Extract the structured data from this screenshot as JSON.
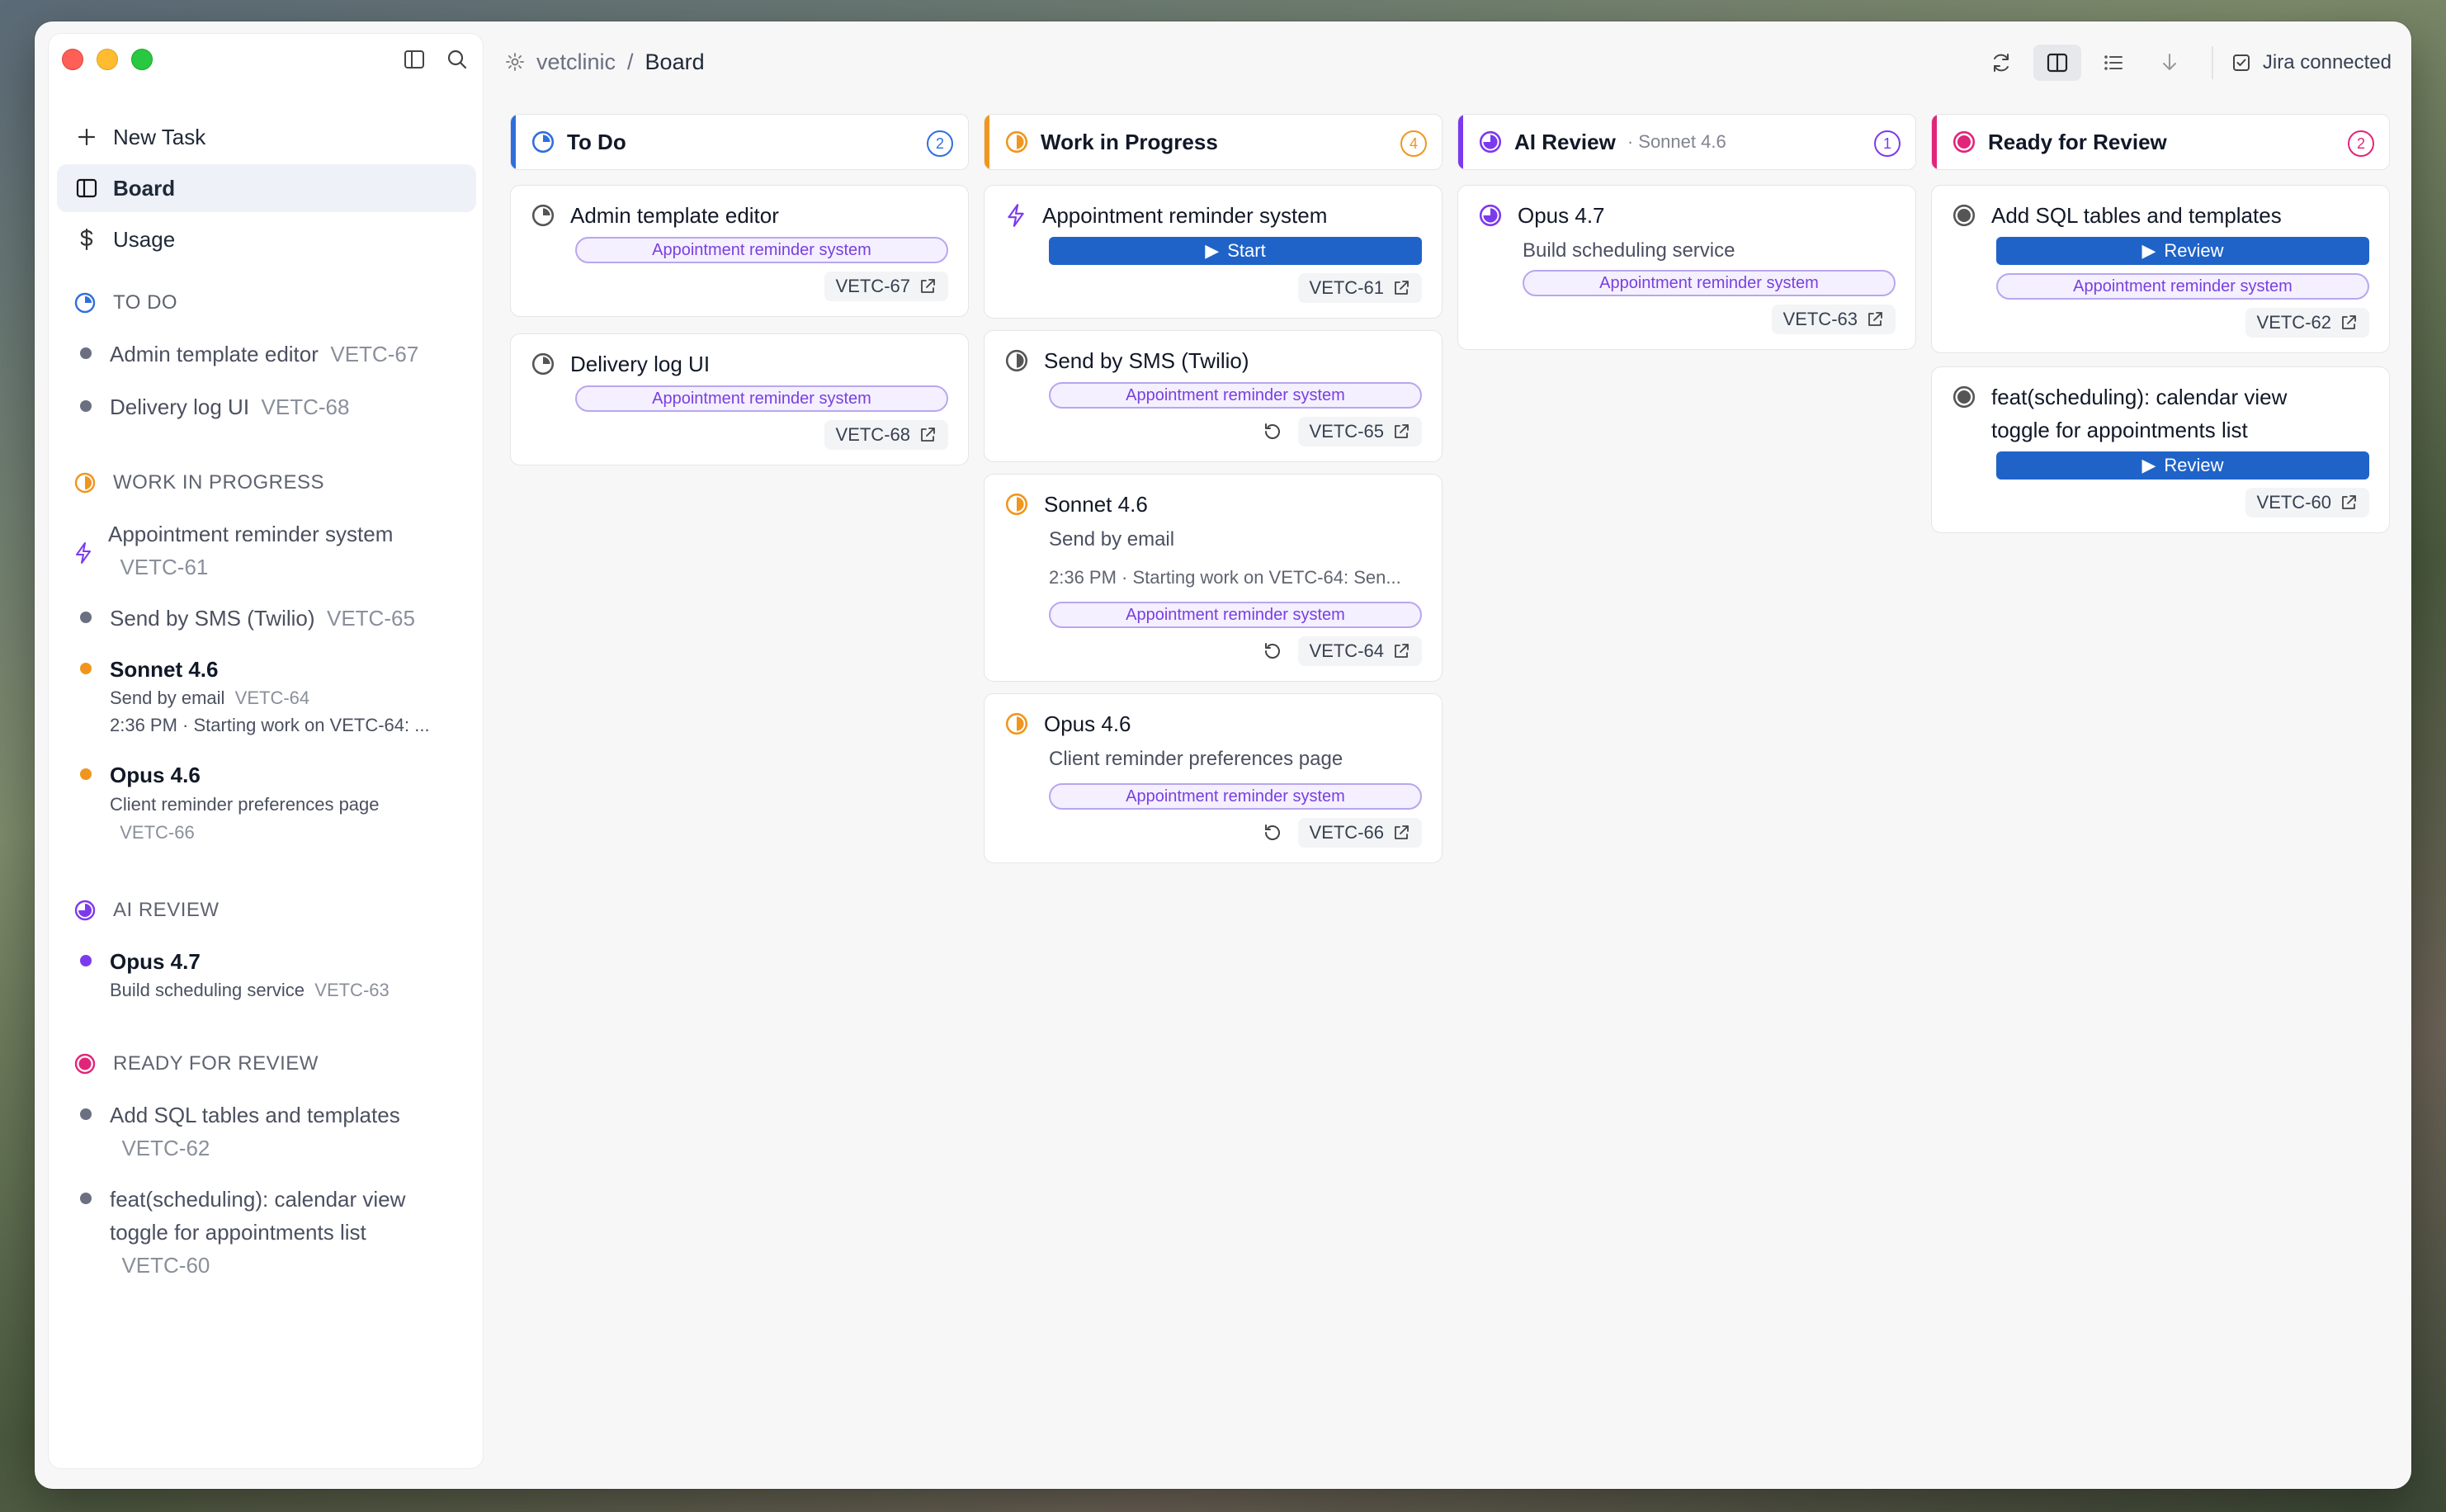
{
  "header": {
    "workspace": "vetclinic",
    "separator": "/",
    "page": "Board",
    "jira_status": "Jira connected"
  },
  "sidebar": {
    "nav": [
      {
        "label": "New Task",
        "icon": "plus-icon"
      },
      {
        "label": "Board",
        "icon": "board-icon"
      },
      {
        "label": "Usage",
        "icon": "dollar-icon"
      }
    ],
    "sections": [
      {
        "title": "TO DO",
        "items": [
          {
            "title": "Admin template editor",
            "key": "VETC-67"
          },
          {
            "title": "Delivery log UI",
            "key": "VETC-68"
          }
        ]
      },
      {
        "title": "WORK IN PROGRESS",
        "items": [
          {
            "title": "Appointment reminder system",
            "key": "VETC-61"
          },
          {
            "title": "Send by SMS (Twilio)",
            "key": "VETC-65"
          },
          {
            "agent": "Sonnet 4.6",
            "title": "Send by email",
            "key": "VETC-64",
            "log": "2:36 PM · Starting work on VETC-64: ..."
          },
          {
            "agent": "Opus 4.6",
            "title": "Client reminder preferences page",
            "key": "VETC-66"
          }
        ]
      },
      {
        "title": "AI REVIEW",
        "items": [
          {
            "agent": "Opus 4.7",
            "title": "Build scheduling service",
            "key": "VETC-63"
          }
        ]
      },
      {
        "title": "READY FOR REVIEW",
        "items": [
          {
            "title": "Add SQL tables and templates",
            "key": "VETC-62"
          },
          {
            "title_line1": "feat(scheduling): calendar view",
            "title_line2": "toggle for appointments list",
            "key": "VETC-60"
          }
        ]
      }
    ]
  },
  "columns": [
    {
      "title": "To Do",
      "count": "2",
      "color": "#2f6fdc",
      "cards": [
        {
          "title": "Admin template editor",
          "tag": "Appointment reminder system",
          "key": "VETC-67"
        },
        {
          "title": "Delivery log UI",
          "tag": "Appointment reminder system",
          "key": "VETC-68"
        }
      ]
    },
    {
      "title": "Work in Progress",
      "count": "4",
      "color": "#f0961e",
      "cards": [
        {
          "title": "Appointment reminder system",
          "button": "Start",
          "key": "VETC-61"
        },
        {
          "title": "Send by SMS (Twilio)",
          "tag": "Appointment reminder system",
          "key": "VETC-65"
        },
        {
          "title": "Sonnet 4.6",
          "subtitle": "Send by email",
          "log": "2:36 PM · Starting work on VETC-64: Sen...",
          "tag": "Appointment reminder system",
          "key": "VETC-64"
        },
        {
          "title": "Opus 4.6",
          "subtitle": "Client reminder preferences page",
          "tag": "Appointment reminder system",
          "key": "VETC-66"
        }
      ]
    },
    {
      "title": "AI Review",
      "model": "· Sonnet 4.6",
      "count": "1",
      "color": "#7c3aed",
      "cards": [
        {
          "title": "Opus 4.7",
          "subtitle": "Build scheduling service",
          "tag": "Appointment reminder system",
          "key": "VETC-63"
        }
      ]
    },
    {
      "title": "Ready for Review",
      "count": "2",
      "color": "#e1257a",
      "cards": [
        {
          "title": "Add SQL tables and templates",
          "button": "Review",
          "tag": "Appointment reminder system",
          "key": "VETC-62"
        },
        {
          "title_line1": "feat(scheduling): calendar view",
          "title_line2": "toggle for appointments list",
          "button": "Review",
          "key": "VETC-60"
        }
      ]
    }
  ],
  "colors": {
    "accent_blue": "#1f63c9",
    "todo": "#2f6fdc",
    "wip": "#f0961e",
    "ai_review": "#7c3aed",
    "ready": "#e1257a",
    "tag_text": "#7a3fe0"
  }
}
